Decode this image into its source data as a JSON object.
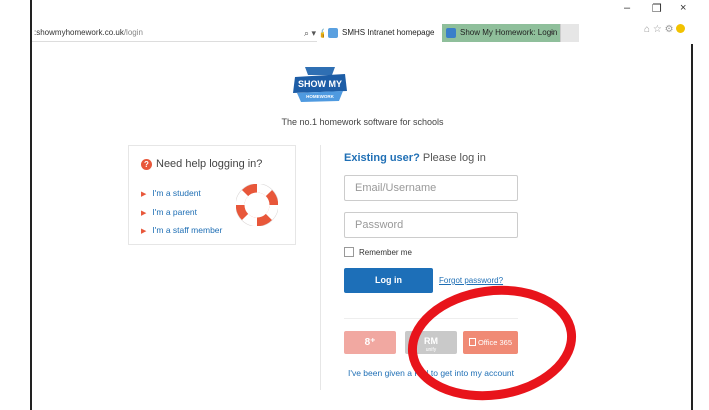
{
  "browser": {
    "address_host": "showmyhomework.co.uk",
    "address_prefix": ":",
    "address_path": "/login",
    "tabs": [
      {
        "label": "SMHS Intranet homepage"
      },
      {
        "label": "Show My Homework: Login"
      }
    ],
    "tab_close": "×",
    "new_tab": "",
    "controls": {
      "minimize": "–",
      "maximize": "❐",
      "close": "×"
    },
    "addr_icons": "⌕ ▾ 🔒 C"
  },
  "logo": {
    "line1": "SHOW MY",
    "line2": "HOMEWORK"
  },
  "tagline": "The no.1 homework software for schools",
  "help": {
    "title": "Need help logging in?",
    "links": [
      "I'm a student",
      "I'm a parent",
      "I'm a staff member"
    ]
  },
  "login": {
    "title_strong": "Existing user?",
    "title_rest": " Please log in",
    "email_placeholder": "Email/Username",
    "password_placeholder": "Password",
    "remember_label": "Remember me",
    "login_button": "Log in",
    "forgot_link": "Forgot password?",
    "google_label": "8⁺",
    "rm_label": "RM",
    "rm_sub": "unify",
    "office_label": "Office 365",
    "rm_pin_text": "I've been given a PIN to get into my account"
  },
  "colors": {
    "primary": "#1d6fb8",
    "annotation": "#e8141b",
    "google": "#f1a8a1",
    "office": "#f08a75"
  }
}
